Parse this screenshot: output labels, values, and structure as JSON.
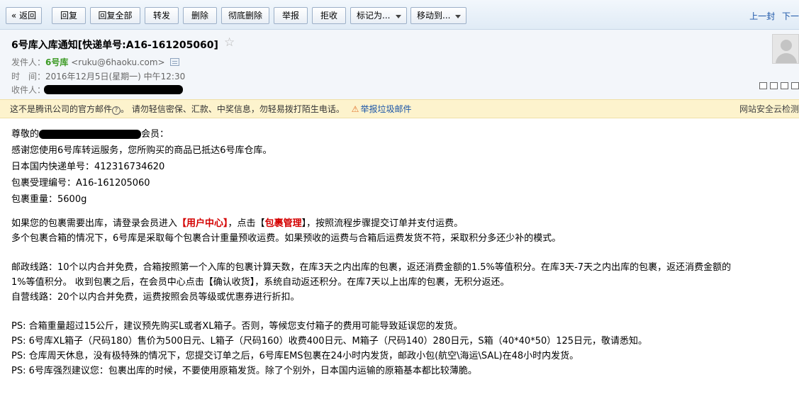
{
  "toolbar": {
    "back": "« 返回",
    "reply": "回复",
    "reply_all": "回复全部",
    "forward": "转发",
    "delete": "删除",
    "delete_forever": "彻底删除",
    "report": "举报",
    "reject": "拒收",
    "mark_as": "标记为...",
    "move_to": "移动到...",
    "prev": "上一封",
    "next": "下一"
  },
  "header": {
    "subject": "6号库入库通知[快递单号:A16-161205060]",
    "from_label": "发件人：",
    "from_name": "6号库",
    "from_addr": "<ruku@6haoku.com>",
    "time_label": "时　间：",
    "time_value": "2016年12月5日(星期一) 中午12:30",
    "to_label": "收件人："
  },
  "warning": {
    "text": "这不是腾讯公司的官方邮件",
    "qmark": "?",
    "advice": "。 请勿轻信密保、汇款、中奖信息，勿轻易拨打陌生电话。",
    "report_link": "举报垃圾邮件",
    "right": "网站安全云检测"
  },
  "body": {
    "salutation_pre": "尊敬的",
    "salutation_post": "会员：",
    "line_thanks": "感谢您使用6号库转运服务，您所购买的商品已抵达6号库仓库。",
    "line_tracking": "日本国内快递单号：412316734620",
    "line_package_id": "包裹受理编号：A16-161205060",
    "line_weight": "包裹重量：5600g",
    "p1_a": "如果您的包裹需要出库，请登录会员进入",
    "p1_hl1": "【用户中心】",
    "p1_b": "，点击",
    "p1_hl2_open": "【",
    "p1_hl2": "包裹管理",
    "p1_hl2_close": "】",
    "p1_c": "，按照流程步骤提交订单并支付运费。",
    "p2": "多个包裹合箱的情况下，6号库是采取每个包裹合计重量预收运费。如果预收的运费与合箱后运费发货不符，采取积分多还少补的模式。",
    "postal_1": "邮政线路：10个以内合并免费，合箱按照第一个入库的包裹计算天数，在库3天之内出库的包裹，返还消费金额的1.5%等值积分。在库3天-7天之内出库的包裹，返还消费金额的",
    "postal_2": "1%等值积分。 收到包裹之后，在会员中心点击【确认收货】，系统自动返还积分。在库7天以上出库的包裹，无积分返还。",
    "self_route": "自营线路：20个以内合并免费，运费按照会员等级或优惠券进行折扣。",
    "ps1": "PS: 合箱重量超过15公斤，建议预先购买L或者XL箱子。否则，等候您支付箱子的费用可能导致延误您的发货。",
    "ps2": "PS: 6号库XL箱子（尺码180）售价为500日元、L箱子（尺码160）收费400日元、M箱子（尺码140）280日元，S箱（40*40*50）125日元，敬请悉知。",
    "ps3": "PS: 仓库周天休息，没有极特殊的情况下，您提交订单之后，6号库EMS包裹在24小时内发货，邮政小包(航空\\海运\\SAL)在48小时内发货。",
    "ps4": "PS: 6号库强烈建议您：包裹出库的时候，不要使用原箱发货。除了个别外，日本国内运输的原箱基本都比较薄脆。"
  },
  "icons": {
    "star": "star-icon",
    "vcard": "contact-card-icon",
    "avatar": "avatar-icon",
    "report": "alert-icon"
  },
  "colors": {
    "toolbar_bg": "#e0ebf6",
    "header_bg": "#f3f6fa",
    "warning_bg": "#fdf3cd",
    "link": "#1b55a8",
    "sender_green": "#3c9a24",
    "highlight_red": "#d40000"
  }
}
